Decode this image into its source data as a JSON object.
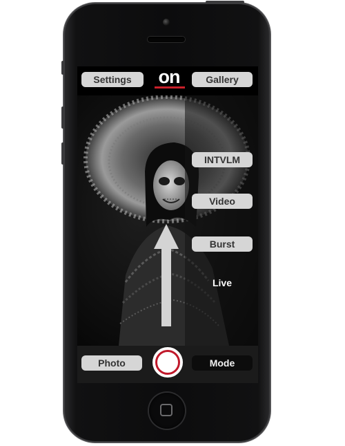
{
  "top_bar": {
    "settings_label": "Settings",
    "logo_text": "on",
    "gallery_label": "Gallery"
  },
  "mode_menu": {
    "items": [
      "INTVLM",
      "Video",
      "Burst",
      "Live"
    ]
  },
  "bottom_bar": {
    "photo_label": "Photo",
    "mode_label": "Mode"
  },
  "colors": {
    "accent_red": "#c0182a",
    "pill_light": "#d6d6d6",
    "pill_dark": "#0c0c0c"
  },
  "icons": {
    "swipe": "up-arrow-icon",
    "shutter": "shutter-button-icon",
    "home": "home-button-icon"
  }
}
